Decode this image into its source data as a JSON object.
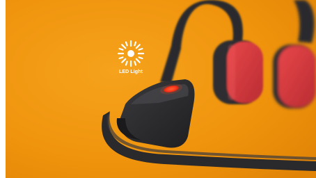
{
  "annotation": {
    "label": "LED Light",
    "icon": "sun-icon"
  },
  "colors": {
    "background": "#f0960e",
    "headband": "#2b2b2e",
    "ear_pad": "#d83a3e",
    "led": "#ff3a1e",
    "label_text": "#ffffff"
  }
}
